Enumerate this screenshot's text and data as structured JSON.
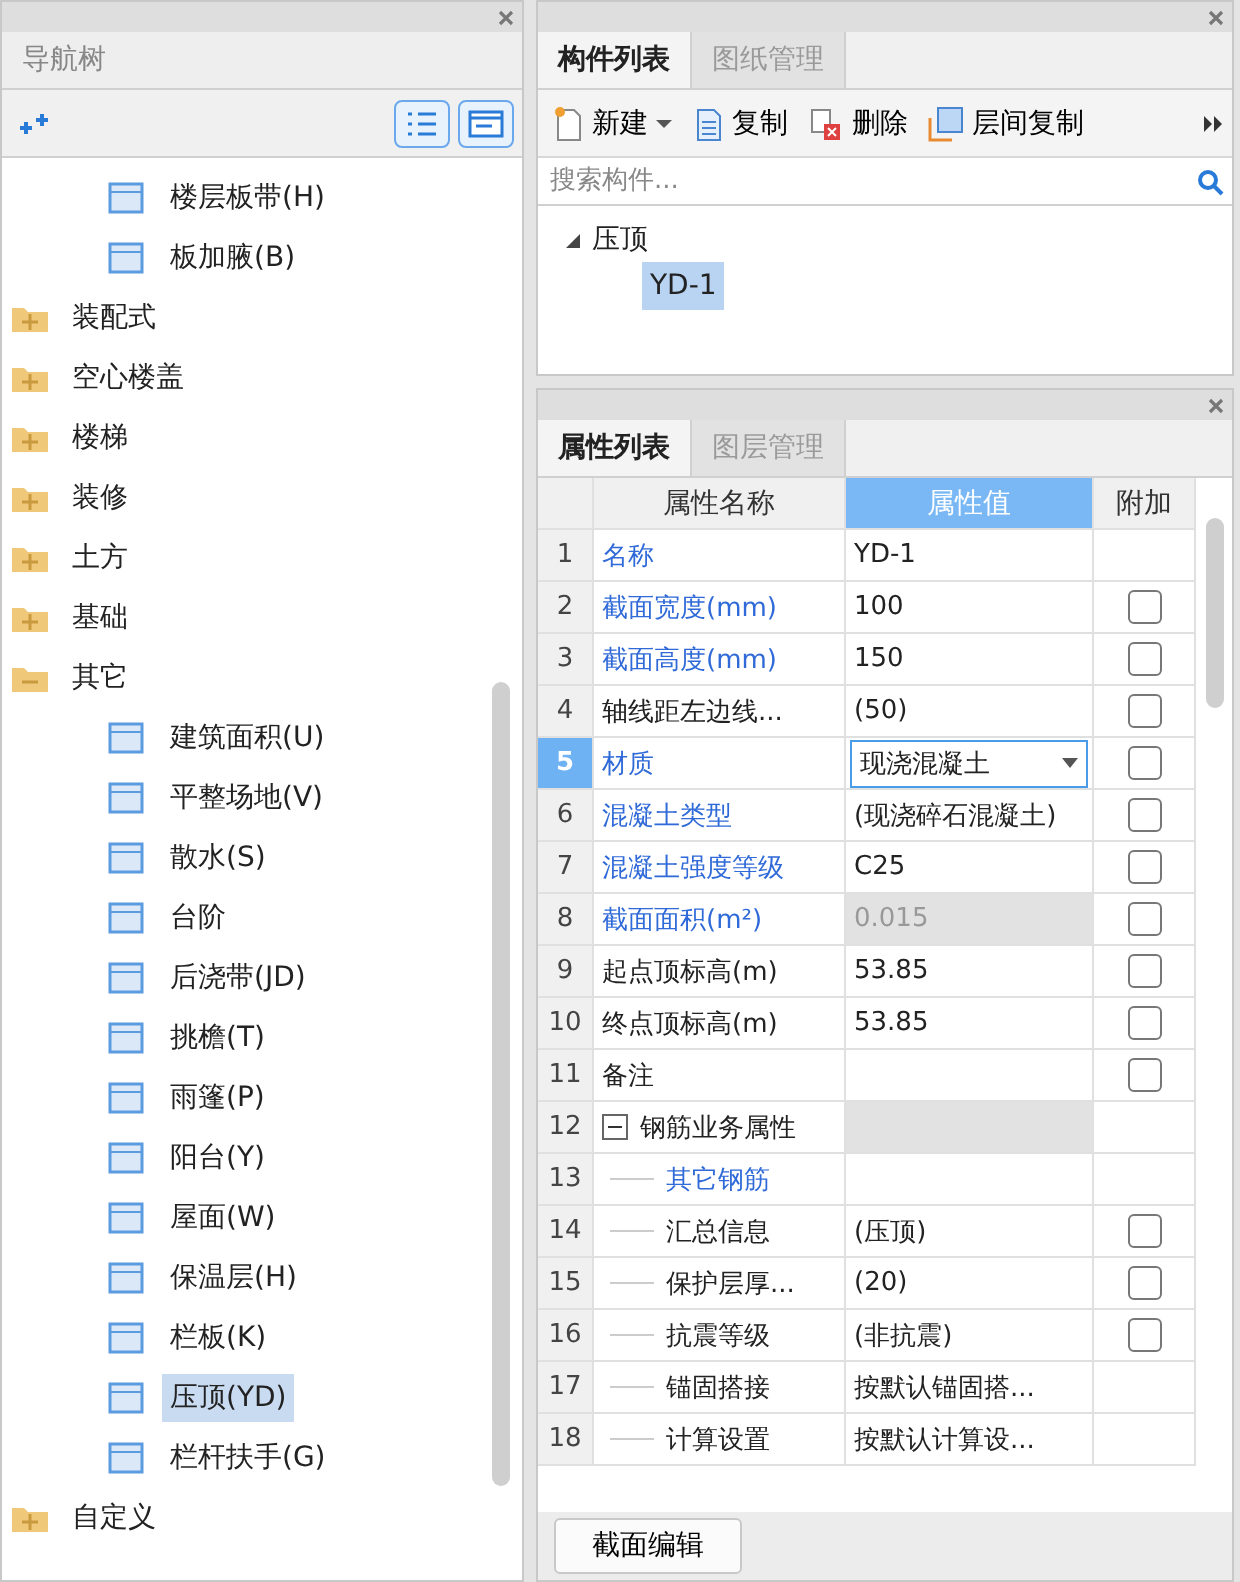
{
  "nav_panel": {
    "title": "导航树",
    "tree": {
      "partial_children": [
        {
          "label": "楼层板带(H)",
          "selected": false
        },
        {
          "label": "板加腋(B)",
          "selected": false
        }
      ],
      "items": [
        {
          "label": "装配式",
          "expanded": false
        },
        {
          "label": "空心楼盖",
          "expanded": false
        },
        {
          "label": "楼梯",
          "expanded": false
        },
        {
          "label": "装修",
          "expanded": false
        },
        {
          "label": "土方",
          "expanded": false
        },
        {
          "label": "基础",
          "expanded": false
        },
        {
          "label": "其它",
          "expanded": true,
          "children": [
            {
              "label": "建筑面积(U)",
              "selected": false
            },
            {
              "label": "平整场地(V)",
              "selected": false
            },
            {
              "label": "散水(S)",
              "selected": false
            },
            {
              "label": "台阶",
              "selected": false
            },
            {
              "label": "后浇带(JD)",
              "selected": false
            },
            {
              "label": "挑檐(T)",
              "selected": false
            },
            {
              "label": "雨篷(P)",
              "selected": false
            },
            {
              "label": "阳台(Y)",
              "selected": false
            },
            {
              "label": "屋面(W)",
              "selected": false
            },
            {
              "label": "保温层(H)",
              "selected": false
            },
            {
              "label": "栏板(K)",
              "selected": false
            },
            {
              "label": "压顶(YD)",
              "selected": true
            },
            {
              "label": "栏杆扶手(G)",
              "selected": false
            }
          ]
        },
        {
          "label": "自定义",
          "expanded": false
        }
      ]
    }
  },
  "component_panel": {
    "tabs": [
      {
        "label": "构件列表",
        "selected": true
      },
      {
        "label": "图纸管理",
        "selected": false
      }
    ],
    "toolbar": [
      {
        "label": "新建",
        "kind": "new",
        "dropdown": true
      },
      {
        "label": "复制",
        "kind": "copy",
        "dropdown": false
      },
      {
        "label": "删除",
        "kind": "delete",
        "dropdown": false
      },
      {
        "label": "层间复制",
        "kind": "floor-copy",
        "dropdown": false
      }
    ],
    "search": {
      "placeholder": "搜索构件..."
    },
    "tree": [
      {
        "label": "压顶",
        "expanded": true,
        "children": [
          {
            "label": "YD-1",
            "selected": true
          }
        ]
      }
    ]
  },
  "property_panel": {
    "tabs": [
      {
        "label": "属性列表",
        "selected": true
      },
      {
        "label": "图层管理",
        "selected": false
      }
    ],
    "columns": [
      {
        "label": "属性名称",
        "selected": false
      },
      {
        "label": "属性值",
        "selected": true
      },
      {
        "label": "附加",
        "selected": false
      }
    ],
    "rows": [
      {
        "num": "1",
        "name": "名称",
        "value": "YD-1",
        "public": true,
        "kind": "text",
        "selected": false,
        "readonly": false
      },
      {
        "num": "2",
        "name": "截面宽度(mm)",
        "value": "100",
        "public": true,
        "kind": "text",
        "selected": false,
        "readonly": false,
        "checked": false
      },
      {
        "num": "3",
        "name": "截面高度(mm)",
        "value": "150",
        "public": true,
        "kind": "text",
        "selected": false,
        "readonly": false,
        "checked": false
      },
      {
        "num": "4",
        "name": "轴线距左边线...",
        "value": "(50)",
        "public": false,
        "kind": "text",
        "selected": false,
        "readonly": false,
        "checked": false
      },
      {
        "num": "5",
        "name": "材质",
        "value": "现浇混凝土",
        "public": true,
        "kind": "dropdown",
        "selected": true,
        "readonly": false,
        "checked": false
      },
      {
        "num": "6",
        "name": "混凝土类型",
        "value": "(现浇碎石混凝土)",
        "public": true,
        "kind": "text",
        "selected": false,
        "readonly": false,
        "checked": false
      },
      {
        "num": "7",
        "name": "混凝土强度等级",
        "value": "C25",
        "public": true,
        "kind": "text",
        "selected": false,
        "readonly": false,
        "checked": false
      },
      {
        "num": "8",
        "name": "截面面积(m²)",
        "value": "0.015",
        "public": true,
        "kind": "text",
        "selected": false,
        "readonly": true,
        "checked": false
      },
      {
        "num": "9",
        "name": "起点顶标高(m)",
        "value": "53.85",
        "public": false,
        "kind": "text",
        "selected": false,
        "readonly": false,
        "checked": false
      },
      {
        "num": "10",
        "name": "终点顶标高(m)",
        "value": "53.85",
        "public": false,
        "kind": "text",
        "selected": false,
        "readonly": false,
        "checked": false
      },
      {
        "num": "11",
        "name": "备注",
        "public": false,
        "kind": "text",
        "selected": false,
        "readonly": false,
        "checked": false
      },
      {
        "num": "12",
        "name": "钢筋业务属性",
        "public": false,
        "kind": "group",
        "selected": false,
        "readonly": true,
        "expanded": true,
        "children": [
          {
            "num": "13",
            "name": "其它钢筋",
            "public": true,
            "kind": "text",
            "selected": false,
            "readonly": false
          },
          {
            "num": "14",
            "name": "汇总信息",
            "value": "(压顶)",
            "public": false,
            "kind": "text",
            "selected": false,
            "readonly": false,
            "checked": false
          },
          {
            "num": "15",
            "name": "保护层厚...",
            "value": "(20)",
            "public": false,
            "kind": "text",
            "selected": false,
            "readonly": false,
            "checked": false
          },
          {
            "num": "16",
            "name": "抗震等级",
            "value": "(非抗震)",
            "public": false,
            "kind": "text",
            "selected": false,
            "readonly": false,
            "checked": false
          },
          {
            "num": "17",
            "name": "锚固搭接",
            "value": "按默认锚固搭...",
            "public": false,
            "kind": "text",
            "selected": false,
            "readonly": false
          },
          {
            "num": "18",
            "name": "计算设置",
            "value": "按默认计算设...",
            "public": false,
            "kind": "text",
            "selected": false,
            "readonly": false
          }
        ]
      }
    ],
    "footer_button": "截面编辑"
  }
}
